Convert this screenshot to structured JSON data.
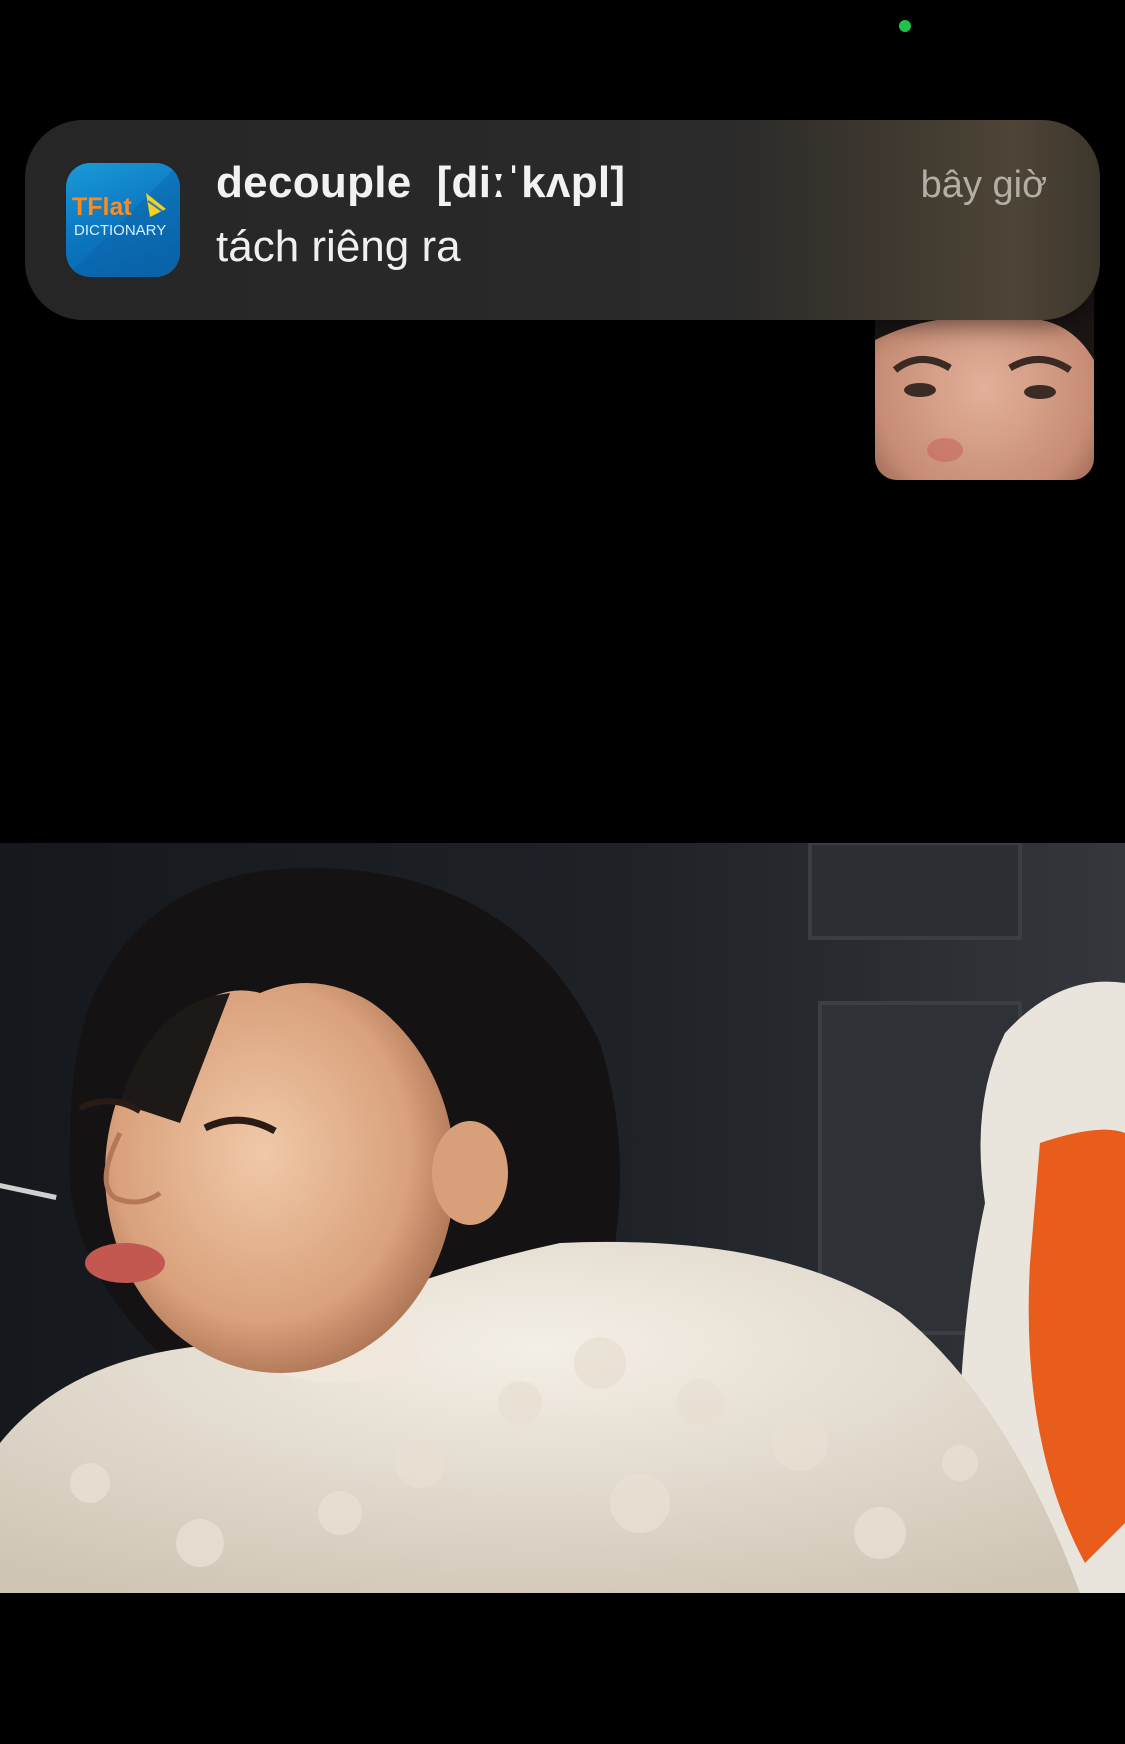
{
  "status": {
    "privacy_indicator_color": "#1fc24a"
  },
  "notification": {
    "app_icon": {
      "name": "tflat-dictionary-icon",
      "text_primary": "TFlat",
      "text_secondary": "DICTIONARY"
    },
    "title": "decouple  [diːˈkʌpl]",
    "body": "tách riêng ra",
    "time": "bây giờ"
  },
  "call": {
    "self_view": "self-camera-preview",
    "remote_video": "remote-participant-video"
  }
}
